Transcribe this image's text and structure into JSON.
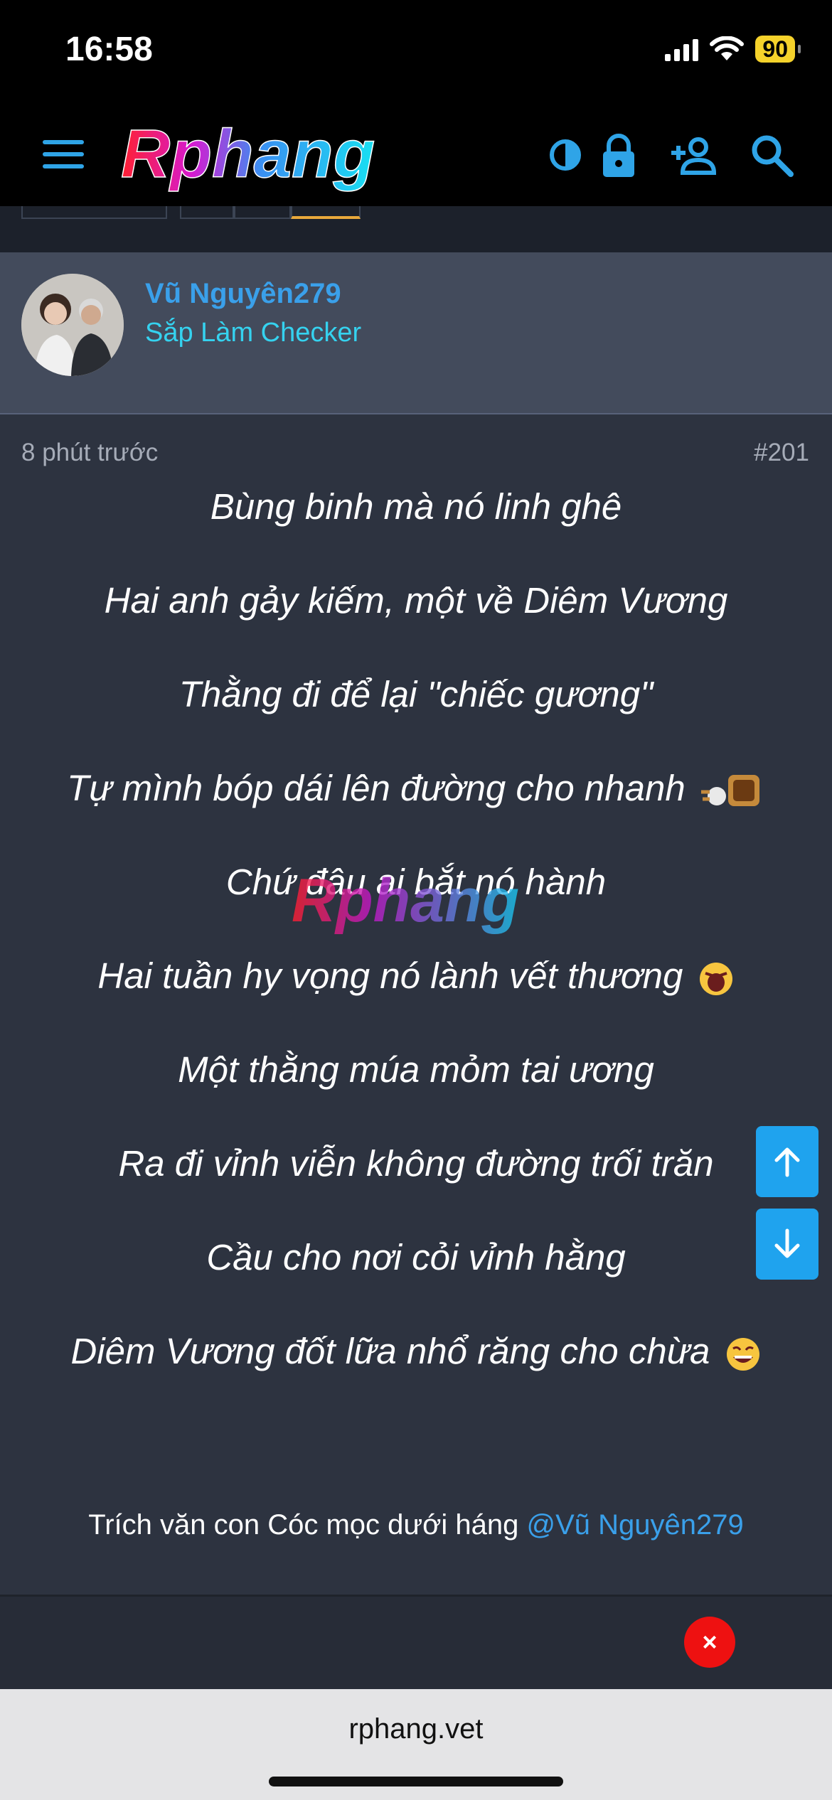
{
  "status": {
    "time": "16:58",
    "battery": "90"
  },
  "site": {
    "logo_text": "Rphang",
    "url": "rphang.vet"
  },
  "author": {
    "name": "Vũ Nguyên279",
    "title": "Sắp Làm Checker"
  },
  "post": {
    "time": "8 phút trước",
    "number": "#201",
    "lines": [
      "Bùng binh mà nó linh ghê",
      "Hai anh gảy kiếm, một về Diêm Vương",
      "Thằng đi để lại \"chiếc gương\"",
      "Tự mình bóp dái lên đường cho nhanh",
      "Chứ đâu ai bắt nó hành",
      "Hai tuần hy vọng nó lành vết thương",
      "Một thằng múa mỏm tai ương",
      "Ra đi vỉnh viễn không đường trối trăn",
      "Cầu cho nơi cỏi vỉnh hằng",
      "Diêm Vương đốt lữa nhổ răng cho chừa"
    ],
    "signature_text": "Trích văn con Cóc mọc dưới háng ",
    "signature_mention": "@Vũ Nguyên279"
  },
  "buttons": {
    "close": "×"
  },
  "colors": {
    "accent": "#2fa4e7",
    "link": "#3aa0ea",
    "title": "#35d2ef",
    "close": "#ee1111"
  }
}
